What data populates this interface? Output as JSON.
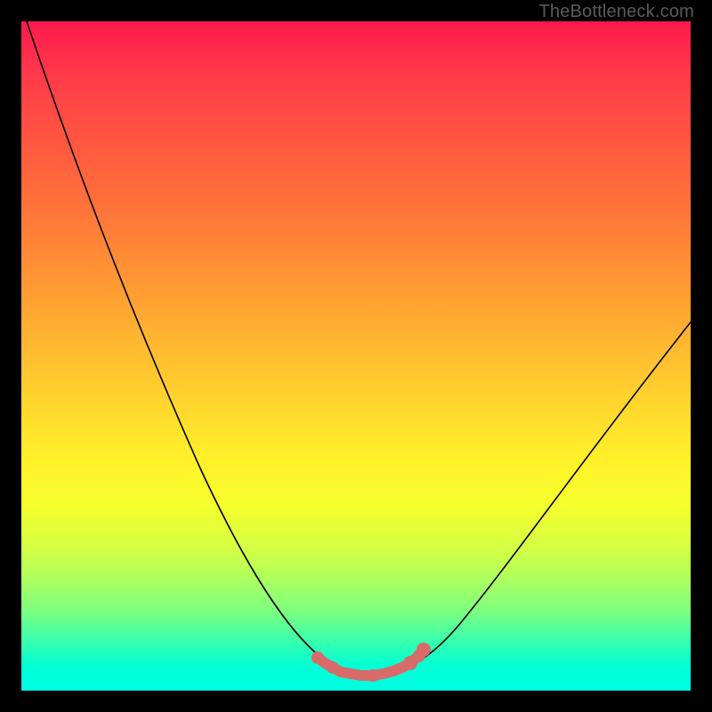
{
  "watermark": "TheBottleneck.com",
  "colors": {
    "frame": "#000000",
    "curve": "#000000",
    "overlay": "#d86a6a"
  },
  "chart_data": {
    "type": "line",
    "title": "",
    "xlabel": "",
    "ylabel": "",
    "xlim": [
      0,
      100
    ],
    "ylim": [
      0,
      100
    ],
    "grid": false,
    "background": "rainbow-vertical-gradient",
    "series": [
      {
        "name": "bottleneck-curve",
        "x": [
          0,
          5,
          10,
          15,
          20,
          25,
          30,
          35,
          40,
          45,
          48,
          50,
          52,
          55,
          58,
          60,
          65,
          70,
          75,
          80,
          85,
          90,
          95,
          100
        ],
        "y": [
          100,
          89,
          78,
          67,
          56,
          45,
          34,
          24,
          16,
          8,
          4,
          3,
          3,
          3,
          4,
          6,
          12,
          20,
          29,
          38,
          47,
          55,
          62,
          67
        ]
      }
    ],
    "highlight": {
      "name": "optimal-zone",
      "x_range": [
        46,
        59
      ],
      "y": 3,
      "dots_x": [
        46,
        48,
        50,
        52,
        55,
        57,
        58,
        59
      ]
    }
  }
}
